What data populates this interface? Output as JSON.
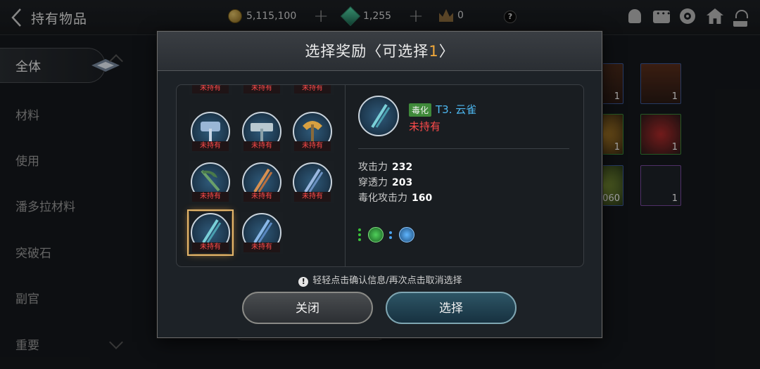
{
  "header": {
    "title": "持有物品",
    "back_icon": "chevron-left-icon",
    "gold": "5,115,100",
    "gems": "1,255",
    "crowns": "0",
    "help": "?"
  },
  "sidebar": {
    "items": [
      {
        "label": "全体"
      },
      {
        "label": "材料"
      },
      {
        "label": "使用"
      },
      {
        "label": "潘多拉材料"
      },
      {
        "label": "突破石"
      },
      {
        "label": "副官"
      },
      {
        "label": "重要"
      }
    ]
  },
  "background_grid": {
    "counts": [
      "1",
      "1",
      "1",
      "1",
      "060",
      "1"
    ]
  },
  "modal": {
    "title_prefix": "选择奖励〈可选择",
    "title_count": "1",
    "title_suffix": "〉",
    "slot_tag": "未持有",
    "detail": {
      "badge": "毒化",
      "name": "T3. 云雀",
      "status": "未持有",
      "stats": [
        {
          "label": "攻击力",
          "value": "232"
        },
        {
          "label": "穿透力",
          "value": "203"
        },
        {
          "label": "毒化攻击力",
          "value": "160"
        }
      ]
    },
    "hint": "轻轻点击确认信息/再次点击取消选择",
    "close_label": "关闭",
    "select_label": "选择"
  },
  "colors": {
    "accent_orange": "#f3a93a",
    "not_owned_red": "#ff4b4b",
    "name_blue": "#4db7f0",
    "poison_green": "#3f8a3a"
  }
}
